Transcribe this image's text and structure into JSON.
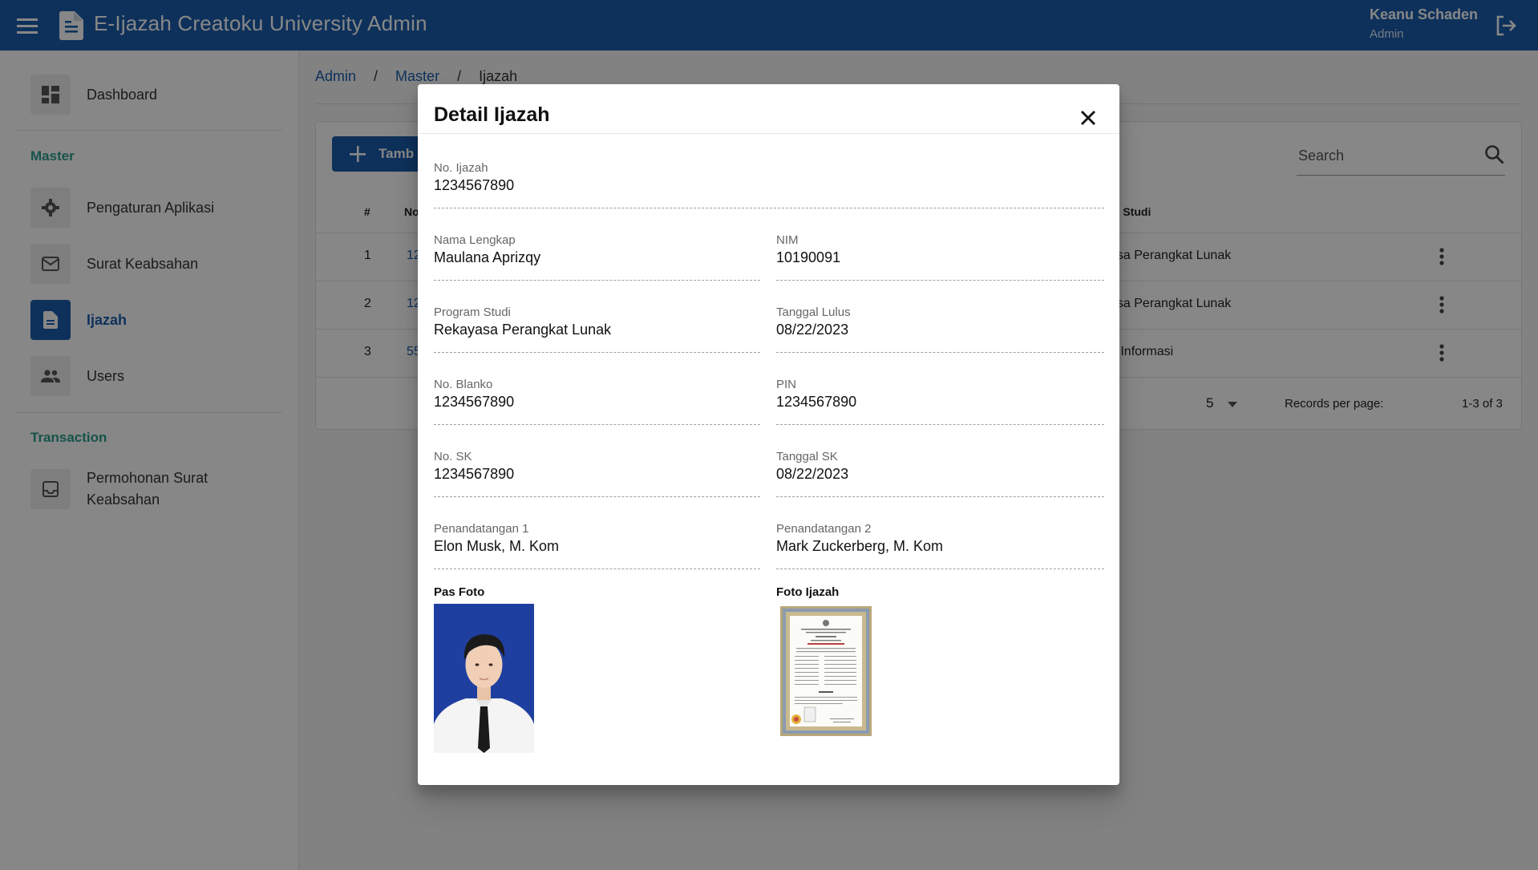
{
  "app": {
    "title": "E-Ijazah Creatoku University Admin",
    "user_name": "Keanu Schaden",
    "user_role": "Admin",
    "brand_color": "#1b5ead"
  },
  "sidebar": {
    "items": [
      {
        "label": "Dashboard",
        "icon": "dashboard-icon"
      },
      {
        "label": "Pengaturan Aplikasi",
        "icon": "gear-icon"
      },
      {
        "label": "Surat Keabsahan",
        "icon": "mail-icon"
      },
      {
        "label": "Ijazah",
        "icon": "document-icon",
        "active": true
      },
      {
        "label": "Users",
        "icon": "users-icon"
      },
      {
        "label": "Permohonan Surat Keabsahan",
        "icon": "inbox-icon"
      }
    ],
    "sections": {
      "master": "Master",
      "transaction": "Transaction"
    }
  },
  "breadcrumb": [
    "Admin",
    "Master",
    "Ijazah"
  ],
  "toolbar": {
    "add_label": "Tamb",
    "search_placeholder": "Search"
  },
  "table": {
    "headers": {
      "index": "#",
      "no": "No",
      "prodi": "m Studi"
    },
    "rows": [
      {
        "no": "1",
        "link": "12",
        "prodi": "asa Perangkat Lunak"
      },
      {
        "no": "2",
        "link": "12",
        "prodi": "asa Perangkat Lunak"
      },
      {
        "no": "3",
        "link": "55",
        "prodi": "n Informasi"
      }
    ],
    "records_label": "Records per page:",
    "records_value": "5",
    "range": "1-3 of 3"
  },
  "dialog": {
    "title": "Detail Ijazah",
    "fields": {
      "no_ijazah": {
        "label": "No. Ijazah",
        "value": "1234567890"
      },
      "nama_lengkap": {
        "label": "Nama Lengkap",
        "value": "Maulana Aprizqy"
      },
      "nim": {
        "label": "NIM",
        "value": "10190091"
      },
      "program_studi": {
        "label": "Program Studi",
        "value": "Rekayasa Perangkat Lunak"
      },
      "tanggal_lulus": {
        "label": "Tanggal Lulus",
        "value": "08/22/2023"
      },
      "no_blanko": {
        "label": "No. Blanko",
        "value": "1234567890"
      },
      "pin": {
        "label": "PIN",
        "value": "1234567890"
      },
      "no_sk": {
        "label": "No. SK",
        "value": "1234567890"
      },
      "tanggal_sk": {
        "label": "Tanggal SK",
        "value": "08/22/2023"
      },
      "penandatangan_1": {
        "label": "Penandatangan 1",
        "value": "Elon Musk, M. Kom"
      },
      "penandatangan_2": {
        "label": "Penandatangan 2",
        "value": "Mark Zuckerberg, M. Kom"
      }
    },
    "pas_foto_label": "Pas Foto",
    "foto_ijazah_label": "Foto Ijazah"
  }
}
